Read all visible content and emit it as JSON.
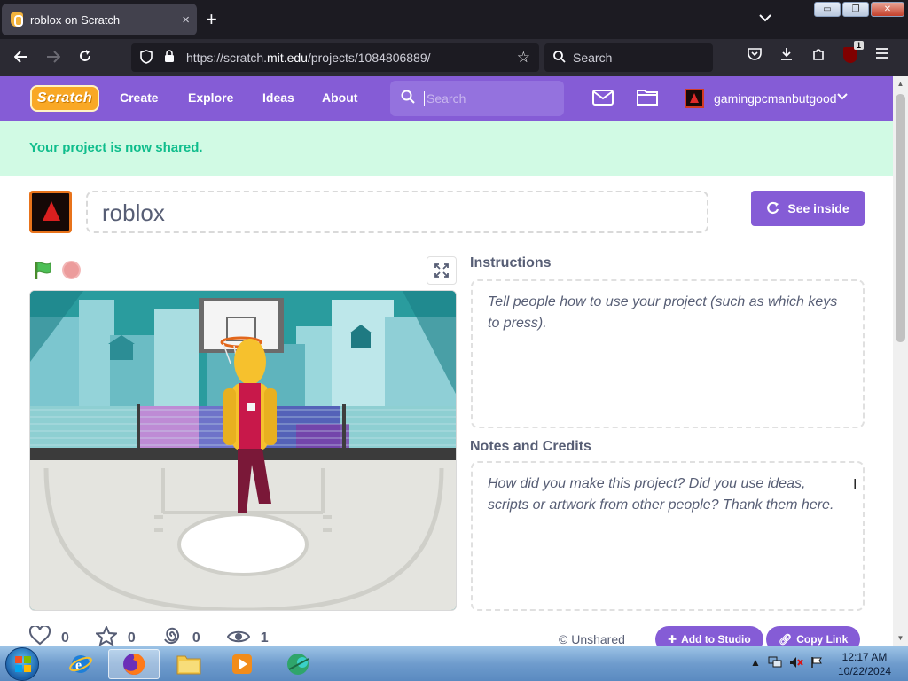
{
  "browser": {
    "tab_title": "roblox on Scratch",
    "tab_close": "×",
    "new_tab": "+",
    "tab_list": "⌄",
    "window_buttons": {
      "minimize": "▭",
      "restore": "❐",
      "close": "✕"
    },
    "url_prefix": "https://scratch.",
    "url_domain": "mit.edu",
    "url_path": "/projects/1084806889/",
    "search_placeholder": "Search",
    "extension_badge": "1"
  },
  "scratch": {
    "logo_text": "Scratch",
    "nav": {
      "create": "Create",
      "explore": "Explore",
      "ideas": "Ideas",
      "about": "About"
    },
    "search_placeholder": "Search",
    "username": "gamingpcmanbutgood",
    "banner": "Your project is now shared.",
    "project_title": "roblox",
    "see_inside": "See inside",
    "instructions_label": "Instructions",
    "instructions_placeholder": "Tell people how to use your project (such as which keys to press).",
    "notes_label": "Notes and Credits",
    "notes_placeholder": "How did you make this project? Did you use ideas, scripts or artwork from other people? Thank them here.",
    "stats": {
      "loves": "0",
      "favorites": "0",
      "remixes": "0",
      "views": "1"
    },
    "unshared": "© Unshared",
    "add_to_studio": "Add to Studio",
    "copy_link": "Copy Link",
    "colors": {
      "brand": "#855cd6",
      "banner_bg": "#d1fae4",
      "banner_text": "#0fbd8c"
    }
  },
  "taskbar": {
    "time": "12:17 AM",
    "date": "10/22/2024"
  }
}
